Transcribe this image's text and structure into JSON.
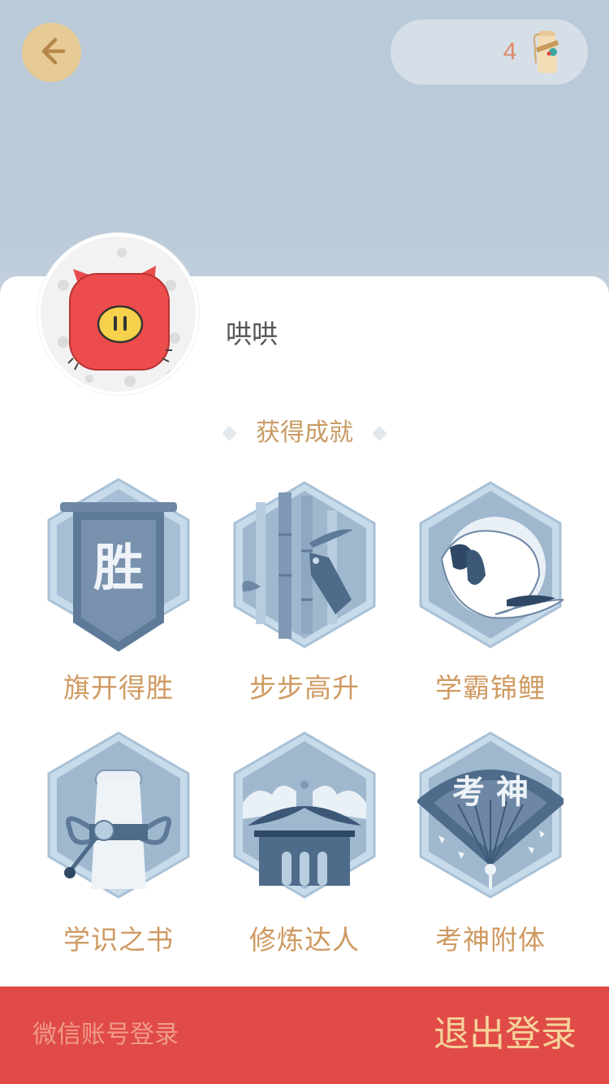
{
  "header": {
    "scroll_count": "4"
  },
  "profile": {
    "username": "哄哄"
  },
  "achievements": {
    "title": "获得成就",
    "items": [
      {
        "label": "旗开得胜",
        "emblem_text": "胜"
      },
      {
        "label": "步步高升"
      },
      {
        "label": "学霸锦鲤"
      },
      {
        "label": "学识之书"
      },
      {
        "label": "修炼达人"
      },
      {
        "label": "考神附体",
        "emblem_text": "考 神"
      }
    ]
  },
  "footer": {
    "wechat_login": "微信账号登录",
    "logout": "退出登录"
  },
  "colors": {
    "accent_gold": "#cf9a62",
    "footer_red": "#e04b47",
    "badge_blue": "#5e7a98"
  }
}
